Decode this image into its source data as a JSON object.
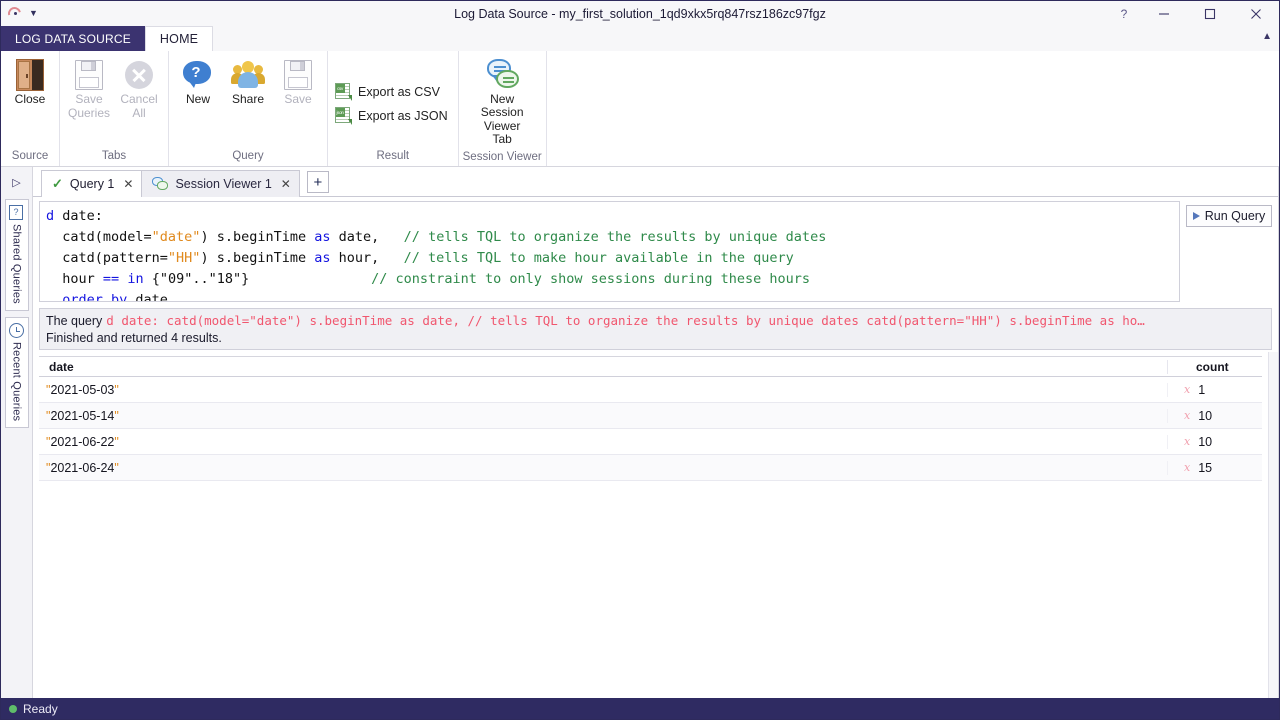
{
  "window": {
    "title": "Log Data Source - my_first_solution_1qd9xkx5rq847rsz186zc97fgz",
    "quick_access_icon": "app-logo-icon",
    "quick_access_dropdown": "chevron-down-icon",
    "help_label": "?",
    "minimize_label": "—",
    "maximize_label": "□",
    "close_label": "✕",
    "ribbon_collapse_icon": "caret-up-icon"
  },
  "ribbon_tabs": {
    "file_tab": "LOG DATA SOURCE",
    "home_tab": "HOME"
  },
  "ribbon": {
    "groups": [
      {
        "label": "Source",
        "buttons": [
          {
            "label": "Close",
            "icon": "door-icon",
            "enabled": true
          }
        ]
      },
      {
        "label": "Tabs",
        "buttons": [
          {
            "label": "Save\nQueries",
            "line1": "Save",
            "line2": "Queries",
            "icon": "floppy-disk-icon",
            "enabled": false
          },
          {
            "label": "Cancel\nAll",
            "line1": "Cancel",
            "line2": "All",
            "icon": "cancel-circle-icon",
            "enabled": false
          }
        ]
      },
      {
        "label": "Query",
        "buttons": [
          {
            "label": "New",
            "icon": "new-query-icon",
            "enabled": true
          },
          {
            "label": "Share",
            "icon": "share-people-icon",
            "enabled": true
          },
          {
            "label": "Save",
            "icon": "floppy-disk-icon",
            "enabled": false
          }
        ]
      },
      {
        "label": "Result",
        "buttons": [
          {
            "label": "Export as CSV",
            "icon": "csv-document-icon",
            "enabled": true
          },
          {
            "label": "Export as JSON",
            "icon": "json-document-icon",
            "enabled": true
          }
        ]
      },
      {
        "label": "Session Viewer",
        "buttons": [
          {
            "line1": "New Session",
            "line2": "Viewer Tab",
            "icon": "session-viewer-icon",
            "enabled": true
          }
        ]
      }
    ]
  },
  "sidebar": {
    "expand_icon": "expand-pane-icon",
    "items": [
      {
        "label": "Shared Queries",
        "icon": "shared-queries-icon"
      },
      {
        "label": "Recent Queries",
        "icon": "clock-icon"
      }
    ]
  },
  "doc_tabs": {
    "tabs": [
      {
        "label": "Query 1",
        "status_icon": "checkmark-icon",
        "close_icon": "close-icon",
        "active": true
      },
      {
        "label": "Session Viewer 1",
        "status_icon": "session-viewer-icon",
        "close_icon": "close-icon",
        "active": false
      }
    ],
    "new_tab_label": "+"
  },
  "editor": {
    "lines": [
      [
        {
          "t": "d",
          "c": "kw"
        },
        {
          "t": " date:",
          "c": "pl"
        }
      ],
      [
        {
          "t": "  catd(model=",
          "c": "pl"
        },
        {
          "t": "\"date\"",
          "c": "str"
        },
        {
          "t": ") s.beginTime ",
          "c": "pl"
        },
        {
          "t": "as",
          "c": "kw"
        },
        {
          "t": " date,",
          "c": "pl"
        },
        {
          "t": "   // tells TQL to organize the results by unique dates",
          "c": "com"
        }
      ],
      [
        {
          "t": "  catd(pattern=",
          "c": "pl"
        },
        {
          "t": "\"HH\"",
          "c": "str"
        },
        {
          "t": ") s.beginTime ",
          "c": "pl"
        },
        {
          "t": "as",
          "c": "kw"
        },
        {
          "t": " hour,",
          "c": "pl"
        },
        {
          "t": "   // tells TQL to make hour available in the query",
          "c": "com"
        }
      ],
      [
        {
          "t": "  hour ",
          "c": "pl"
        },
        {
          "t": "==",
          "c": "kw"
        },
        {
          "t": " ",
          "c": "pl"
        },
        {
          "t": "in",
          "c": "kw"
        },
        {
          "t": " {\"09\"..\"18\"}",
          "c": "pl"
        },
        {
          "t": "               // constraint to only show sessions during these hours",
          "c": "com"
        }
      ],
      [
        {
          "t": "  ",
          "c": "pl"
        },
        {
          "t": "order by",
          "c": "kw"
        },
        {
          "t": " date",
          "c": "pl"
        }
      ]
    ],
    "run_button_label": "Run Query",
    "run_button_icon": "play-icon"
  },
  "status_panel": {
    "prefix": "The query",
    "query_text": "d date:    catd(model=\"date\") s.beginTime as date,  // tells TQL to organize the results by unique dates   catd(pattern=\"HH\") s.beginTime as ho…",
    "result_text": "Finished and returned 4 results."
  },
  "results_table": {
    "columns": [
      "date",
      "count"
    ],
    "rows": [
      {
        "date": "\"2021-05-03\"",
        "count": "1",
        "count_icon": "fx-icon"
      },
      {
        "date": "\"2021-05-14\"",
        "count": "10",
        "count_icon": "fx-icon"
      },
      {
        "date": "\"2021-06-22\"",
        "count": "10",
        "count_icon": "fx-icon"
      },
      {
        "date": "\"2021-06-24\"",
        "count": "15",
        "count_icon": "fx-icon"
      }
    ]
  },
  "statusbar": {
    "status": "Ready",
    "status_color": "#5fbd6a"
  },
  "colors": {
    "brand_dark": "#3b3370",
    "statusbar_bg": "#2f2b62",
    "keyword": "#1414e0",
    "string": "#e08a1e",
    "comment": "#2f8a4a",
    "query_echo": "#f1566e"
  }
}
